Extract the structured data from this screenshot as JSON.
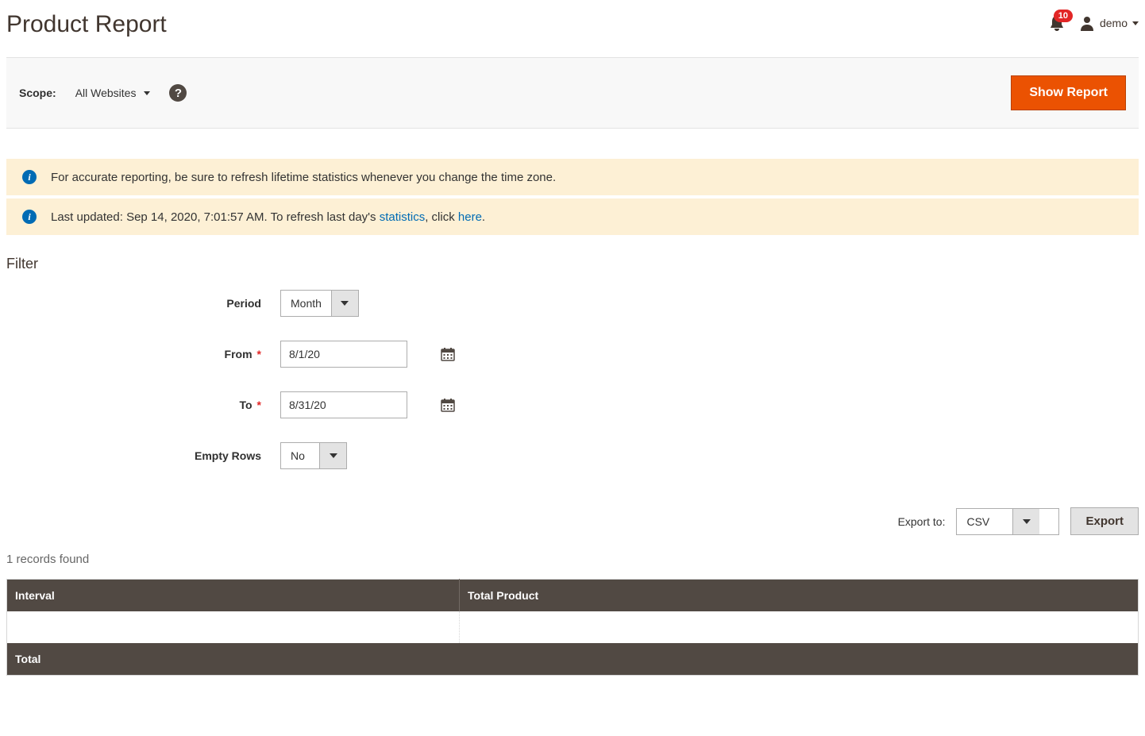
{
  "header": {
    "title": "Product Report",
    "notification_count": "10",
    "user_label": "demo"
  },
  "scope": {
    "label": "Scope:",
    "selected": "All Websites",
    "action_button": "Show Report"
  },
  "messages": [
    {
      "prefix": "For accurate reporting, be sure to refresh lifetime statistics whenever you change the time zone.",
      "links": []
    },
    {
      "prefix": "Last updated: Sep 14, 2020, 7:01:57 AM. To refresh last day's ",
      "link1": "statistics",
      "mid": ", click ",
      "link2": "here",
      "suffix": "."
    }
  ],
  "filter": {
    "section_title": "Filter",
    "labels": {
      "period": "Period",
      "from": "From",
      "to": "To",
      "empty_rows": "Empty Rows"
    },
    "values": {
      "period": "Month",
      "from": "8/1/20",
      "to": "8/31/20",
      "empty_rows": "No"
    }
  },
  "export": {
    "label": "Export to:",
    "format": "CSV",
    "button": "Export"
  },
  "records_found": "1 records found",
  "table": {
    "columns": [
      "Interval",
      "Total Product"
    ],
    "rows": [
      {
        "interval": "",
        "total_product": ""
      }
    ],
    "footer_label": "Total",
    "footer_total": ""
  }
}
